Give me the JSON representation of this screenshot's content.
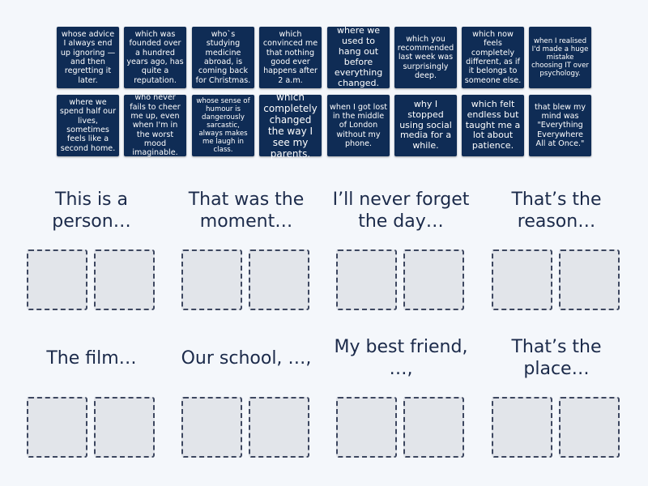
{
  "tiles": [
    "whose advice I always end up ignoring — and then regretting it later.",
    "which was founded over a hundred years ago, has quite a reputation.",
    "who`s studying medicine abroad, is coming back for Christmas.",
    "which convinced me that nothing good ever happens after 2 a.m.",
    "where we used to hang out before everything changed.",
    "which you recommended last week was surprisingly deep.",
    "which now feels completely different, as if it belongs to someone else.",
    "when I realised I'd made a huge mistake choosing IT over psychology.",
    "where we spend half our lives, sometimes feels like a second home.",
    "who never fails to cheer me up, even when I'm in the worst mood imaginable.",
    "whose sense of humour is dangerously sarcastic, always makes me laugh in class.",
    "which completely changed the way I see my parents.",
    "when I got lost in the middle of London without my phone.",
    "why I stopped using social media for a while.",
    "which felt endless but taught me a lot about patience.",
    "that blew my mind was \"Everything Everywhere All at Once.\""
  ],
  "groups": [
    "This is a person…",
    "That was the moment…",
    "I’ll never forget the day…",
    "That’s the reason…",
    "The film…",
    "Our school, …,",
    "My best friend, …,",
    "That’s the place…"
  ]
}
